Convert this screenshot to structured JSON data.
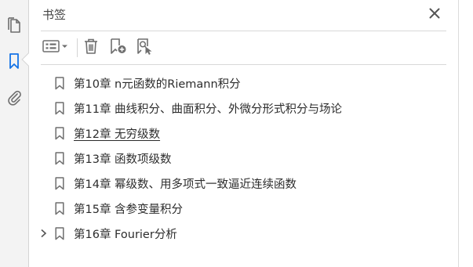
{
  "panel": {
    "title": "书签",
    "close_glyph": "✕"
  },
  "rail": {
    "items": [
      {
        "icon": "pages-icon",
        "active": false
      },
      {
        "icon": "bookmark-icon",
        "active": true
      },
      {
        "icon": "attachment-icon",
        "active": false
      }
    ]
  },
  "toolbar": {
    "items": [
      {
        "icon": "options-menu-icon"
      },
      {
        "icon": "trash-icon"
      },
      {
        "icon": "new-bookmark-icon"
      },
      {
        "icon": "find-bookmark-icon"
      }
    ]
  },
  "bookmarks": [
    {
      "label": "第10章  n元函数的Riemann积分",
      "expandable": false,
      "underlined": false
    },
    {
      "label": "第11章  曲线积分、曲面积分、外微分形式积分与场论",
      "expandable": false,
      "underlined": false
    },
    {
      "label": "第12章  无穷级数",
      "expandable": false,
      "underlined": true
    },
    {
      "label": "第13章  函数项级数",
      "expandable": false,
      "underlined": false
    },
    {
      "label": "第14章  幂级数、用多项式一致逼近连续函数",
      "expandable": false,
      "underlined": false
    },
    {
      "label": "第15章  含参变量积分",
      "expandable": false,
      "underlined": false
    },
    {
      "label": "第16章  Fourier分析",
      "expandable": true,
      "underlined": false
    }
  ],
  "colors": {
    "active_rail_icon": "#1473e6",
    "icon_gray": "#6e6e6e",
    "text": "#2c2c2c"
  }
}
